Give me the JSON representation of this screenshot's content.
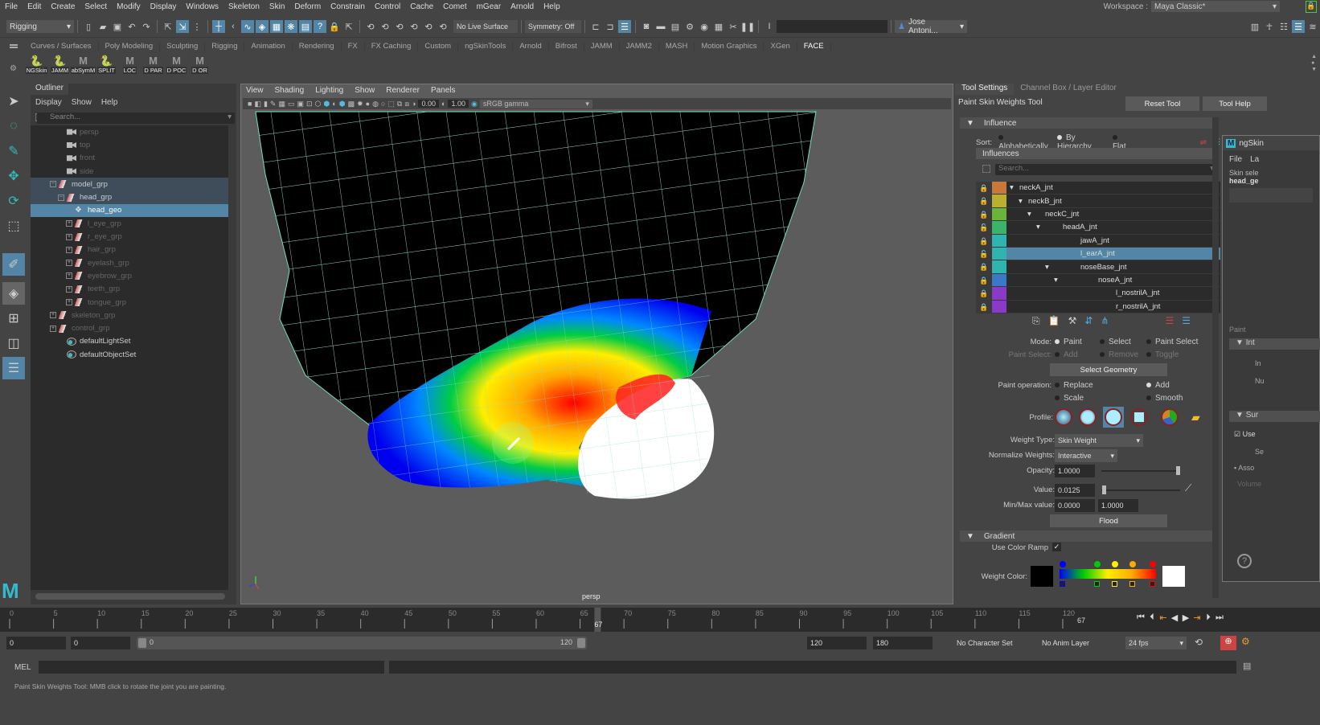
{
  "menubar": [
    "File",
    "Edit",
    "Create",
    "Select",
    "Modify",
    "Display",
    "Windows",
    "Skeleton",
    "Skin",
    "Deform",
    "Constrain",
    "Control",
    "Cache",
    "Comet",
    "mGear",
    "Arnold",
    "Help"
  ],
  "workspace": {
    "label": "Workspace :",
    "value": "Maya Classic*"
  },
  "statusline": {
    "mode": "Rigging",
    "live_surface": "No Live Surface",
    "symmetry": "Symmetry: Off",
    "user": "Jose Antoni..."
  },
  "shelf": {
    "tabs": [
      "Curves / Surfaces",
      "Poly Modeling",
      "Sculpting",
      "Rigging",
      "Animation",
      "Rendering",
      "FX",
      "FX Caching",
      "Custom",
      "ngSkinTools",
      "Arnold",
      "Bifrost",
      "JAMM",
      "JAMM2",
      "MASH",
      "Motion Graphics",
      "XGen",
      "FACE"
    ],
    "active_tab": "FACE",
    "items": [
      {
        "label": "NGSkin",
        "icon": "python-icon"
      },
      {
        "label": "JAMM",
        "icon": "python-icon"
      },
      {
        "label": "abSymM",
        "icon": "mel-icon"
      },
      {
        "label": "SPLIT",
        "icon": "python-icon"
      },
      {
        "label": "LOC",
        "icon": "mel-icon"
      },
      {
        "label": "D PAR",
        "icon": "mel-icon"
      },
      {
        "label": "D POC",
        "icon": "mel-icon"
      },
      {
        "label": "D OR",
        "icon": "mel-icon"
      }
    ]
  },
  "outliner": {
    "title": "Outliner",
    "menu": [
      "Display",
      "Show",
      "Help"
    ],
    "search_placeholder": "Search...",
    "items": [
      {
        "label": "persp",
        "type": "camera",
        "indent": 2,
        "dim": true
      },
      {
        "label": "top",
        "type": "camera",
        "indent": 2,
        "dim": true
      },
      {
        "label": "front",
        "type": "camera",
        "indent": 2,
        "dim": true
      },
      {
        "label": "side",
        "type": "camera",
        "indent": 2,
        "dim": true
      },
      {
        "label": "model_grp",
        "type": "group",
        "indent": 1,
        "expanded": true,
        "state": "hl"
      },
      {
        "label": "head_grp",
        "type": "group",
        "indent": 2,
        "expanded": true,
        "state": "hl"
      },
      {
        "label": "head_geo",
        "type": "mesh",
        "indent": 3,
        "state": "sel"
      },
      {
        "label": "l_eye_grp",
        "type": "group",
        "indent": 3,
        "collapsed": true,
        "dim": true
      },
      {
        "label": "r_eye_grp",
        "type": "group",
        "indent": 3,
        "collapsed": true,
        "dim": true
      },
      {
        "label": "hair_grp",
        "type": "group",
        "indent": 3,
        "collapsed": true,
        "dim": true
      },
      {
        "label": "eyelash_grp",
        "type": "group",
        "indent": 3,
        "collapsed": true,
        "dim": true
      },
      {
        "label": "eyebrow_grp",
        "type": "group",
        "indent": 3,
        "collapsed": true,
        "dim": true
      },
      {
        "label": "teeth_grp",
        "type": "group",
        "indent": 3,
        "collapsed": true,
        "dim": true
      },
      {
        "label": "tongue_grp",
        "type": "group",
        "indent": 3,
        "collapsed": true,
        "dim": true
      },
      {
        "label": "skeleton_grp",
        "type": "group",
        "indent": 1,
        "collapsed": true,
        "dim": true
      },
      {
        "label": "control_grp",
        "type": "group",
        "indent": 1,
        "collapsed": true,
        "dim": true
      },
      {
        "label": "defaultLightSet",
        "type": "set",
        "indent": 2
      },
      {
        "label": "defaultObjectSet",
        "type": "set",
        "indent": 2
      }
    ]
  },
  "viewport": {
    "menu": [
      "View",
      "Shading",
      "Lighting",
      "Show",
      "Renderer",
      "Panels"
    ],
    "exposure": "0.00",
    "gamma": "1.00",
    "colorspace": "sRGB gamma",
    "camera": "persp"
  },
  "tool_settings": {
    "tabs": [
      "Tool Settings",
      "Channel Box / Layer Editor"
    ],
    "tool_name": "Paint Skin Weights Tool",
    "reset": "Reset Tool",
    "help": "Tool Help",
    "influence_header": "Influence",
    "sort_label": "Sort:",
    "sort_options": [
      "Alphabetically",
      "By Hierarchy",
      "Flat"
    ],
    "sort_selected": "By Hierarchy",
    "influences_header": "Influences",
    "search_placeholder": "Search...",
    "influences": [
      {
        "name": "neckA_jnt",
        "color": "#c8783a",
        "depth": 0,
        "locked": true
      },
      {
        "name": "neckB_jnt",
        "color": "#b8b030",
        "depth": 1,
        "locked": true
      },
      {
        "name": "neckC_jnt",
        "color": "#6ab43a",
        "depth": 2,
        "locked": true
      },
      {
        "name": "headA_jnt",
        "color": "#3ab46a",
        "depth": 3,
        "locked": false
      },
      {
        "name": "jawA_jnt",
        "color": "#30b4b0",
        "depth": 4,
        "locked": true,
        "leaf": true
      },
      {
        "name": "l_earA_jnt",
        "color": "#30b4b0",
        "depth": 4,
        "locked": false,
        "leaf": true,
        "selected": true
      },
      {
        "name": "noseBase_jnt",
        "color": "#30b4b0",
        "depth": 4,
        "locked": true
      },
      {
        "name": "noseA_jnt",
        "color": "#3a78c8",
        "depth": 5,
        "locked": true
      },
      {
        "name": "l_nostrilA_jnt",
        "color": "#8a3ac8",
        "depth": 6,
        "locked": true,
        "leaf": true
      },
      {
        "name": "r_nostrilA_jnt",
        "color": "#8a3ac8",
        "depth": 6,
        "locked": true,
        "leaf": true
      }
    ],
    "mode_label": "Mode:",
    "mode_options": [
      "Paint",
      "Select",
      "Paint Select"
    ],
    "mode_selected": "Paint",
    "paint_select_label": "Paint Select:",
    "paint_select_options": [
      "Add",
      "Remove",
      "Toggle"
    ],
    "select_geometry": "Select Geometry",
    "paint_op_label": "Paint operation:",
    "paint_ops": [
      "Replace",
      "Add",
      "Scale",
      "Smooth"
    ],
    "paint_op_selected": "Add",
    "profile_label": "Profile:",
    "weight_type_label": "Weight Type:",
    "weight_type": "Skin Weight",
    "normalize_label": "Normalize Weights:",
    "normalize": "Interactive",
    "opacity_label": "Opacity:",
    "opacity": "1.0000",
    "opacity_fraction": 1.0,
    "value_label": "Value:",
    "value": "0.0125",
    "value_fraction": 0.0125,
    "minmax_label": "Min/Max value:",
    "min": "0.0000",
    "max": "1.0000",
    "flood": "Flood",
    "gradient_header": "Gradient",
    "use_color_ramp_label": "Use Color Ramp",
    "use_color_ramp": true,
    "weight_color_label": "Weight Color:",
    "ramp_stops": [
      "#0000ff",
      "#00cc00",
      "#ffee00",
      "#ffaa00",
      "#ff0000"
    ]
  },
  "ngskin": {
    "title": "ngSkin",
    "menu": [
      "File",
      "La"
    ],
    "skin_sel": "Skin sele",
    "mesh": "head_ge",
    "paint_tab": "Paint",
    "sections": [
      "Int",
      "Sur"
    ],
    "use_label": "Use",
    "asso_label": "Asso",
    "volume_label": "Volume",
    "row_labels": [
      "In",
      "Nu",
      "Se"
    ]
  },
  "timeline": {
    "ticks": [
      "0",
      "5",
      "10",
      "15",
      "20",
      "25",
      "30",
      "35",
      "40",
      "45",
      "50",
      "55",
      "60",
      "65",
      "70",
      "75",
      "80",
      "85",
      "90",
      "95",
      "100",
      "105",
      "110",
      "115",
      "120"
    ],
    "current_frame": "67",
    "current_frame_field": "67"
  },
  "range": {
    "start": "0",
    "anim_start": "0",
    "slider_start": "0",
    "slider_end": "120",
    "end": "120",
    "anim_end": "180",
    "character_set": "No Character Set",
    "anim_layer": "No Anim Layer",
    "fps": "24 fps"
  },
  "cmdline": {
    "label": "MEL"
  },
  "helpline": "Paint Skin Weights Tool: MMB click to rotate the joint you are painting."
}
